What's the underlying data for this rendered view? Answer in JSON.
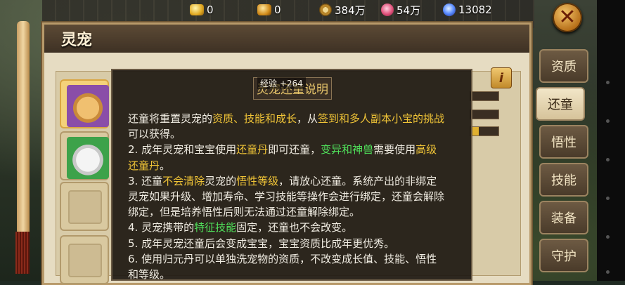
{
  "currencies": [
    {
      "icon": "gold-ingot-icon",
      "value": "0"
    },
    {
      "icon": "gold-ingot-small-icon",
      "value": "0"
    },
    {
      "icon": "copper-coin-icon",
      "value": "384万"
    },
    {
      "icon": "pink-gem-icon",
      "value": "54万"
    },
    {
      "icon": "blue-orb-icon",
      "value": "13082"
    }
  ],
  "panel": {
    "title": "灵宠"
  },
  "tabs": [
    {
      "label": "资质",
      "active": false
    },
    {
      "label": "还童",
      "active": true
    },
    {
      "label": "悟性",
      "active": false
    },
    {
      "label": "技能",
      "active": false
    },
    {
      "label": "装备",
      "active": false
    },
    {
      "label": "守护",
      "active": false
    }
  ],
  "info_button": "i",
  "tooltip": {
    "title": "灵宠还童说明",
    "exp_toast": "经验 +264",
    "lines": [
      [
        {
          "t": "还童将重置灵宠的",
          "c": ""
        },
        {
          "t": "资质、技能和成长",
          "c": "y"
        },
        {
          "t": "，从",
          "c": ""
        },
        {
          "t": "签到和多人副本小宝的挑战",
          "c": "y"
        }
      ],
      [
        {
          "t": "可以获得。",
          "c": ""
        }
      ],
      [
        {
          "t": "2. 成年灵宠和宝宝使用",
          "c": ""
        },
        {
          "t": "还童丹",
          "c": "y"
        },
        {
          "t": "即可还童，",
          "c": ""
        },
        {
          "t": "变异和神兽",
          "c": "g"
        },
        {
          "t": "需要使用",
          "c": ""
        },
        {
          "t": "高级",
          "c": "y"
        }
      ],
      [
        {
          "t": "还童丹",
          "c": "y"
        },
        {
          "t": "。",
          "c": ""
        }
      ],
      [
        {
          "t": "3. 还童",
          "c": ""
        },
        {
          "t": "不会清除",
          "c": "y"
        },
        {
          "t": "灵宠的",
          "c": ""
        },
        {
          "t": "悟性等级",
          "c": "y"
        },
        {
          "t": "，请放心还童。系统产出的非绑定",
          "c": ""
        }
      ],
      [
        {
          "t": "灵宠如果升级、增加寿命、学习技能等操作会进行绑定，还童会解除",
          "c": ""
        }
      ],
      [
        {
          "t": "绑定，但是培养悟性后则无法通过还童解除绑定。",
          "c": ""
        }
      ],
      [
        {
          "t": "4. 灵宠携带的",
          "c": ""
        },
        {
          "t": "特征技能",
          "c": "g"
        },
        {
          "t": "固定，还童也不会改变。",
          "c": ""
        }
      ],
      [
        {
          "t": "5. 成年灵宠还童后会变成宝宝，宝宝资质比成年更优秀。",
          "c": ""
        }
      ],
      [
        {
          "t": "6. 使用归元丹可以单独洗宠物的资质，不改变成长值、技能、悟性",
          "c": ""
        }
      ],
      [
        {
          "t": "和等级。",
          "c": ""
        }
      ]
    ]
  }
}
